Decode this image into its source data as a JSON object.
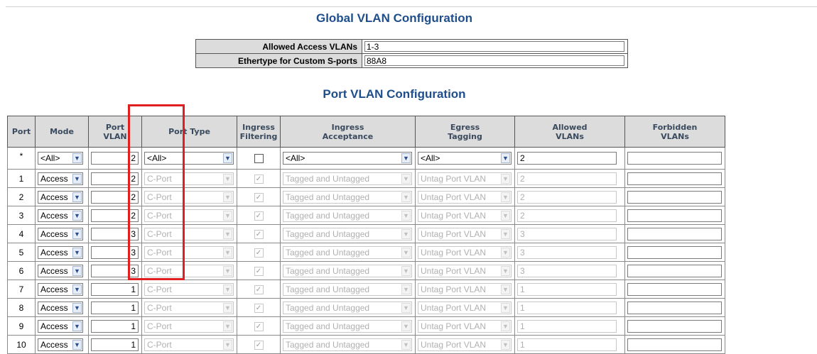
{
  "global": {
    "title": "Global VLAN Configuration",
    "allowed_access_vlans_label": "Allowed Access VLANs",
    "allowed_access_vlans_value": "1-3",
    "ethertype_label": "Ethertype for Custom S-ports",
    "ethertype_value": "88A8"
  },
  "port_vlan": {
    "title": "Port VLAN Configuration",
    "columns": {
      "port": "Port",
      "mode": "Mode",
      "port_vlan_1": "Port",
      "port_vlan_2": "VLAN",
      "port_type": "Port Type",
      "ingress_filtering_1": "Ingress",
      "ingress_filtering_2": "Filtering",
      "ingress_acceptance_1": "Ingress",
      "ingress_acceptance_2": "Acceptance",
      "egress_tagging_1": "Egress",
      "egress_tagging_2": "Tagging",
      "allowed_vlans_1": "Allowed",
      "allowed_vlans_2": "VLANs",
      "forbidden_vlans_1": "Forbidden",
      "forbidden_vlans_2": "VLANs"
    },
    "all_row": {
      "port": "*",
      "mode": "<All>",
      "port_vlan": "2",
      "port_type": "<All>",
      "ingress_filtering": false,
      "ingress_acceptance": "<All>",
      "egress_tagging": "<All>",
      "allowed_vlans": "2",
      "forbidden_vlans": ""
    },
    "rows": [
      {
        "port": "1",
        "mode": "Access",
        "port_vlan": "2",
        "port_type": "C-Port",
        "ingress_filtering": true,
        "ingress_acceptance": "Tagged and Untagged",
        "egress_tagging": "Untag Port VLAN",
        "allowed_vlans": "2",
        "forbidden_vlans": ""
      },
      {
        "port": "2",
        "mode": "Access",
        "port_vlan": "2",
        "port_type": "C-Port",
        "ingress_filtering": true,
        "ingress_acceptance": "Tagged and Untagged",
        "egress_tagging": "Untag Port VLAN",
        "allowed_vlans": "2",
        "forbidden_vlans": ""
      },
      {
        "port": "3",
        "mode": "Access",
        "port_vlan": "2",
        "port_type": "C-Port",
        "ingress_filtering": true,
        "ingress_acceptance": "Tagged and Untagged",
        "egress_tagging": "Untag Port VLAN",
        "allowed_vlans": "2",
        "forbidden_vlans": ""
      },
      {
        "port": "4",
        "mode": "Access",
        "port_vlan": "3",
        "port_type": "C-Port",
        "ingress_filtering": true,
        "ingress_acceptance": "Tagged and Untagged",
        "egress_tagging": "Untag Port VLAN",
        "allowed_vlans": "3",
        "forbidden_vlans": ""
      },
      {
        "port": "5",
        "mode": "Access",
        "port_vlan": "3",
        "port_type": "C-Port",
        "ingress_filtering": true,
        "ingress_acceptance": "Tagged and Untagged",
        "egress_tagging": "Untag Port VLAN",
        "allowed_vlans": "3",
        "forbidden_vlans": ""
      },
      {
        "port": "6",
        "mode": "Access",
        "port_vlan": "3",
        "port_type": "C-Port",
        "ingress_filtering": true,
        "ingress_acceptance": "Tagged and Untagged",
        "egress_tagging": "Untag Port VLAN",
        "allowed_vlans": "3",
        "forbidden_vlans": ""
      },
      {
        "port": "7",
        "mode": "Access",
        "port_vlan": "1",
        "port_type": "C-Port",
        "ingress_filtering": true,
        "ingress_acceptance": "Tagged and Untagged",
        "egress_tagging": "Untag Port VLAN",
        "allowed_vlans": "1",
        "forbidden_vlans": ""
      },
      {
        "port": "8",
        "mode": "Access",
        "port_vlan": "1",
        "port_type": "C-Port",
        "ingress_filtering": true,
        "ingress_acceptance": "Tagged and Untagged",
        "egress_tagging": "Untag Port VLAN",
        "allowed_vlans": "1",
        "forbidden_vlans": ""
      },
      {
        "port": "9",
        "mode": "Access",
        "port_vlan": "1",
        "port_type": "C-Port",
        "ingress_filtering": true,
        "ingress_acceptance": "Tagged and Untagged",
        "egress_tagging": "Untag Port VLAN",
        "allowed_vlans": "1",
        "forbidden_vlans": ""
      },
      {
        "port": "10",
        "mode": "Access",
        "port_vlan": "1",
        "port_type": "C-Port",
        "ingress_filtering": true,
        "ingress_acceptance": "Tagged and Untagged",
        "egress_tagging": "Untag Port VLAN",
        "allowed_vlans": "1",
        "forbidden_vlans": ""
      }
    ]
  },
  "icons": {
    "dropdown_arrow": "chevron-down-icon",
    "checkbox_check": "checkmark-icon"
  },
  "colors": {
    "title": "#1f4e8c",
    "header_bg": "#dcdcdc",
    "highlight": "#e02020"
  }
}
